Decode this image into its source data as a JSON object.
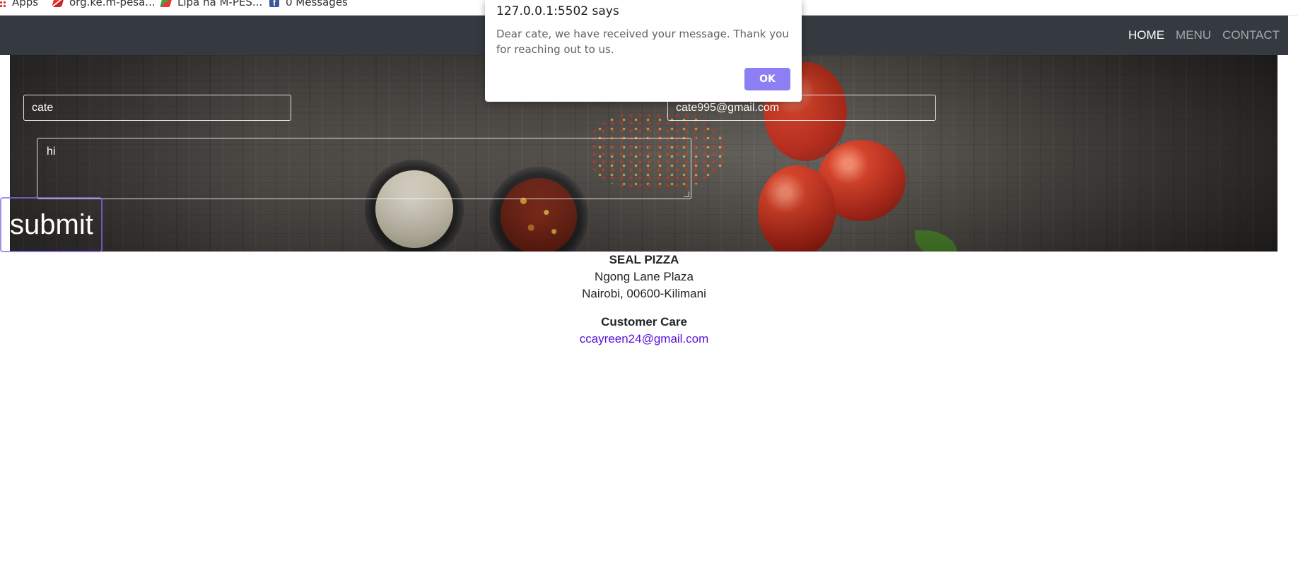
{
  "bookmarks": [
    {
      "label": "Apps",
      "icon": "apps-grid-icon"
    },
    {
      "label": "org.ke.m-pesa...",
      "icon": "mpesa-icon"
    },
    {
      "label": "Lipa na M-PES...",
      "icon": "lipa-icon"
    },
    {
      "label": "0 Messages",
      "icon": "facebook-icon"
    }
  ],
  "nav": {
    "home": "HOME",
    "menu": "MENU",
    "contact": "CONTACT"
  },
  "form": {
    "name_value": "cate",
    "email_value": "cate995@gmail.com",
    "message_value": "hi",
    "submit_label": "submit"
  },
  "dialog": {
    "title": "127.0.0.1:5502 says",
    "message": "Dear cate, we have received your message. Thank you for reaching out to us.",
    "ok_label": "OK",
    "ok_color": "#8c7ff3"
  },
  "footer": {
    "business_name": "SEAL PIZZA",
    "address_line1": "Ngong Lane Plaza",
    "address_line2": "Nairobi, 00600-Kilimani",
    "customer_care_heading": "Customer Care",
    "customer_care_email": "ccayreen24@gmail.com"
  },
  "colors": {
    "navbar": "#343a40",
    "link": "#5a10d6"
  }
}
